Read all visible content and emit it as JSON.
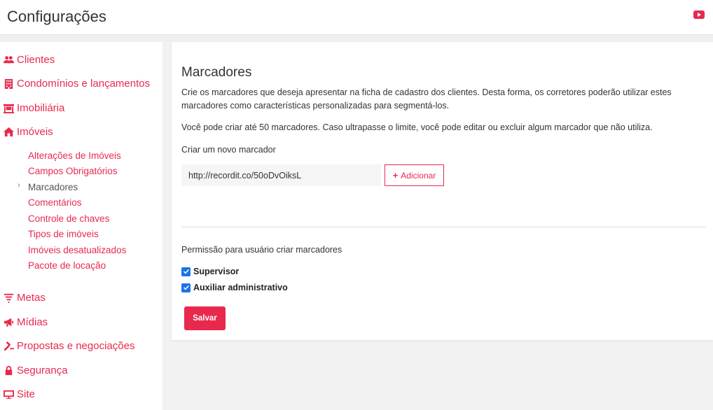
{
  "header": {
    "title": "Configurações",
    "youtube_icon": "youtube-icon"
  },
  "colors": {
    "accent": "#e8294d",
    "checkbox": "#1a73e8"
  },
  "sidebar": {
    "items": [
      {
        "label": "Clientes",
        "icon": "users-icon"
      },
      {
        "label": "Condomínios e lançamentos",
        "icon": "building-icon"
      },
      {
        "label": "Imobiliária",
        "icon": "store-icon"
      },
      {
        "label": "Imóveis",
        "icon": "home-icon"
      },
      {
        "label": "Metas",
        "icon": "filter-icon"
      },
      {
        "label": "Mídias",
        "icon": "megaphone-icon"
      },
      {
        "label": "Propostas e negociações",
        "icon": "gavel-icon"
      },
      {
        "label": "Segurança",
        "icon": "lock-icon"
      },
      {
        "label": "Site",
        "icon": "monitor-icon"
      }
    ],
    "subitems": [
      {
        "label": "Alterações de Imóveis"
      },
      {
        "label": "Campos Obrigatórios"
      },
      {
        "label": "Marcadores",
        "active": true
      },
      {
        "label": "Comentários"
      },
      {
        "label": "Controle de chaves"
      },
      {
        "label": "Tipos de imóveis"
      },
      {
        "label": "Imóveis desatualizados"
      },
      {
        "label": "Pacote de locação"
      }
    ],
    "active_chevron": "›"
  },
  "main": {
    "title": "Marcadores",
    "description": "Crie os marcadores que deseja apresentar na ficha de cadastro dos clientes. Desta forma, os corretores poderão utilizar estes marcadores como características personalizadas para segmentá-los.",
    "limit_text": "Você pode criar até 50 marcadores. Caso ultrapasse o limite, você pode editar ou excluir algum marcador que não utiliza.",
    "new_label": "Criar um novo marcador",
    "input_value": "http://recordit.co/50oDvOiksL",
    "add_button": "Adicionar",
    "add_button_icon": "+",
    "permission_label": "Permissão para usuário criar marcadores",
    "checkboxes": [
      {
        "label": "Supervisor",
        "checked": true
      },
      {
        "label": "Auxiliar administrativo",
        "checked": true
      }
    ],
    "save_button": "Salvar"
  }
}
